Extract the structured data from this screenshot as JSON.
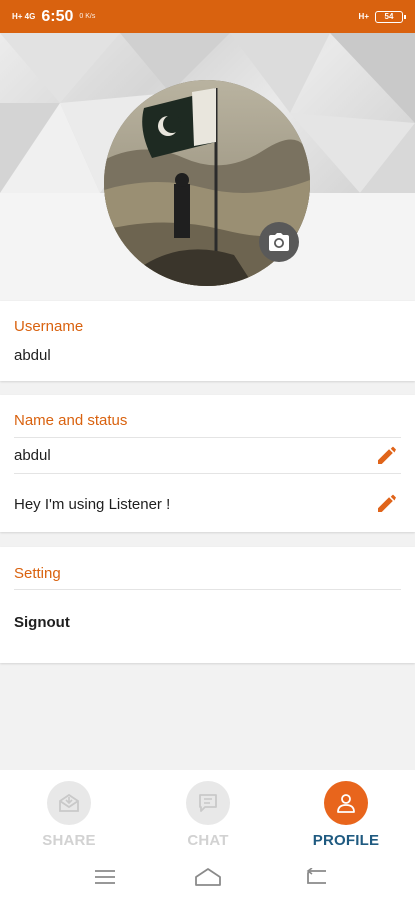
{
  "status_bar": {
    "signal_text": "H+ 4G",
    "time": "6:50",
    "speed": "0 K/s",
    "network": "H+",
    "battery": "54"
  },
  "profile": {
    "avatar_description_icon": "profile-photo",
    "camera_icon": "camera-icon"
  },
  "username_section": {
    "title": "Username",
    "value": "abdul"
  },
  "name_status_section": {
    "title": "Name and status",
    "name": "abdul",
    "status": "Hey I'm using Listener !"
  },
  "setting_section": {
    "title": "Setting",
    "signout_label": "Signout"
  },
  "bottom_nav": {
    "items": [
      {
        "label": "SHARE",
        "icon": "mail-share-icon",
        "active": false
      },
      {
        "label": "CHAT",
        "icon": "chat-icon",
        "active": false
      },
      {
        "label": "PROFILE",
        "icon": "person-icon",
        "active": true
      }
    ]
  },
  "colors": {
    "accent": "#d9620f",
    "active_label": "#1f5a80"
  }
}
